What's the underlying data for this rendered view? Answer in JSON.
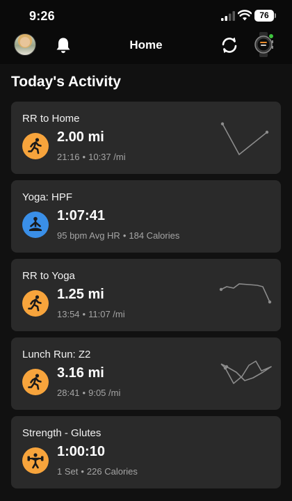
{
  "status_bar": {
    "time": "9:26",
    "battery": "76",
    "icons": [
      "signal-icon",
      "wifi-icon",
      "battery-icon"
    ]
  },
  "header": {
    "title": "Home",
    "icons": [
      "avatar",
      "bell-icon",
      "sync-icon",
      "watch-icon"
    ],
    "status_color": "#3ec43e"
  },
  "section_title": "Today's Activity",
  "colors": {
    "accent_orange": "#f7a43c",
    "accent_blue": "#3a8fe8",
    "card_bg": "#2a2a2a"
  },
  "activities": [
    {
      "title": "RR to Home",
      "value": "2.00 mi",
      "stat1": "21:16",
      "stat2": "10:37 /mi",
      "icon": "running-icon",
      "icon_color": "#f7a43c",
      "has_route": true
    },
    {
      "title": "Yoga: HPF",
      "value": "1:07:41",
      "stat1": "95 bpm Avg HR",
      "stat2": "184 Calories",
      "icon": "yoga-icon",
      "icon_color": "#3a8fe8",
      "has_route": false
    },
    {
      "title": "RR to Yoga",
      "value": "1.25 mi",
      "stat1": "13:54",
      "stat2": "11:07 /mi",
      "icon": "running-icon",
      "icon_color": "#f7a43c",
      "has_route": true
    },
    {
      "title": "Lunch Run: Z2",
      "value": "3.16 mi",
      "stat1": "28:41",
      "stat2": "9:05 /mi",
      "icon": "running-icon",
      "icon_color": "#f7a43c",
      "has_route": true
    },
    {
      "title": "Strength - Glutes",
      "value": "1:00:10",
      "stat1": "1 Set",
      "stat2": "226 Calories",
      "icon": "strength-icon",
      "icon_color": "#f7a43c",
      "has_route": false
    }
  ]
}
